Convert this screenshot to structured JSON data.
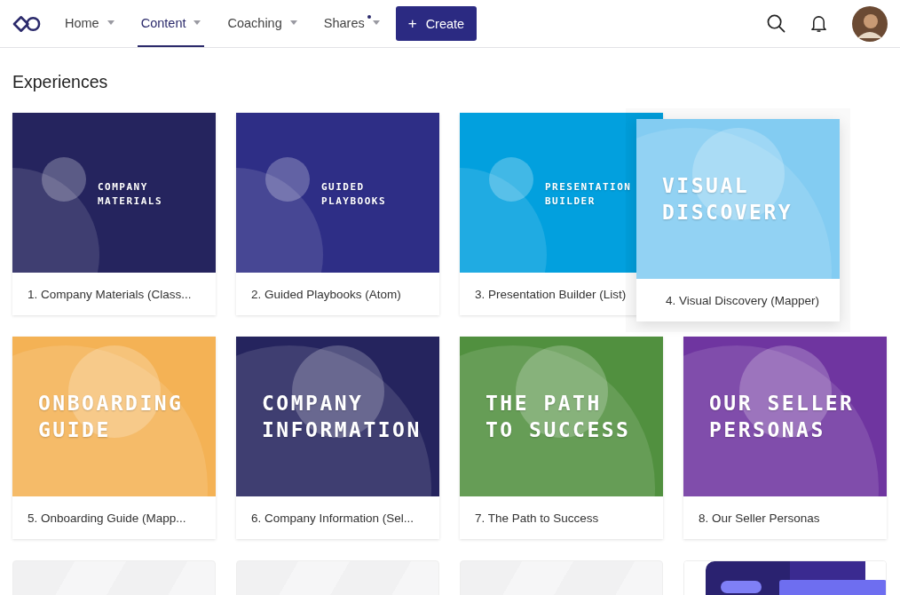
{
  "nav": {
    "items": [
      {
        "label": "Home",
        "selected": false,
        "caret": true,
        "dot": false
      },
      {
        "label": "Content",
        "selected": true,
        "caret": true,
        "dot": false
      },
      {
        "label": "Coaching",
        "selected": false,
        "caret": true,
        "dot": false
      },
      {
        "label": "Shares",
        "selected": false,
        "caret": true,
        "dot": true
      }
    ],
    "create_button": {
      "icon": "+",
      "label": "Create"
    }
  },
  "section_title": "Experiences",
  "cards": [
    {
      "kind": "small",
      "cover_title": "COMPANY\nMATERIALS",
      "caption": "1. Company Materials (Class...",
      "color": "#25245e",
      "dragging": false
    },
    {
      "kind": "small",
      "cover_title": "GUIDED\nPLAYBOOKS",
      "caption": "2. Guided Playbooks (Atom)",
      "color": "#2e2e86",
      "dragging": false
    },
    {
      "kind": "small",
      "cover_title": "PRESENTATION\nBUILDER",
      "caption": "3. Presentation Builder (List)",
      "color": "#02a0de",
      "dragging": false
    },
    {
      "kind": "large",
      "cover_title": "VISUAL\nDISCOVERY",
      "caption": "4. Visual Discovery (Mapper)",
      "color": "#83ccf2",
      "dragging": true
    },
    {
      "kind": "large",
      "cover_title": "ONBOARDING\nGUIDE",
      "caption": "5. Onboarding Guide (Mapp...",
      "color": "#f4b255",
      "dragging": false
    },
    {
      "kind": "large",
      "cover_title": "COMPANY\nINFORMATION",
      "caption": "6. Company Information (Sel...",
      "color": "#25245e",
      "dragging": false
    },
    {
      "kind": "large",
      "cover_title": "THE PATH\nTO SUCCESS",
      "caption": "7. The Path to Success",
      "color": "#51903f",
      "dragging": false
    },
    {
      "kind": "large",
      "cover_title": "OUR SELLER\nPERSONAS",
      "caption": "8. Our Seller Personas",
      "color": "#6f35a0",
      "dragging": false
    }
  ],
  "next_row": [
    {
      "kind": "skeleton"
    },
    {
      "kind": "skeleton"
    },
    {
      "kind": "skeleton"
    },
    {
      "kind": "picture"
    }
  ]
}
